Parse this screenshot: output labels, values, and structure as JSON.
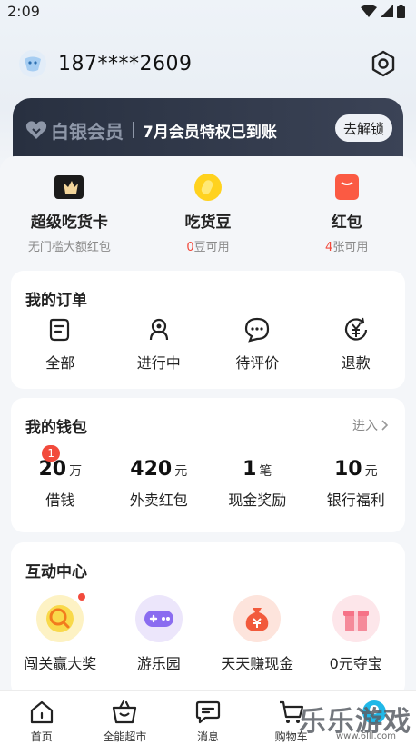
{
  "status_bar": {
    "time": "2:09"
  },
  "profile": {
    "phone": "187****2609"
  },
  "vip": {
    "brand": "白银会员",
    "message": "7月会员特权已到账",
    "button": "去解锁"
  },
  "assets": [
    {
      "title": "超级吃货卡",
      "sub": "无门槛大额红包",
      "sub_num": "",
      "sub_rest": ""
    },
    {
      "title": "吃货豆",
      "sub": "",
      "sub_num": "0",
      "sub_rest": "豆可用"
    },
    {
      "title": "红包",
      "sub": "",
      "sub_num": "4",
      "sub_rest": "张可用"
    }
  ],
  "orders": {
    "title": "我的订单",
    "items": [
      {
        "label": "全部",
        "icon": "document-icon"
      },
      {
        "label": "进行中",
        "icon": "rider-icon"
      },
      {
        "label": "待评价",
        "icon": "chat-bubble-icon"
      },
      {
        "label": "退款",
        "icon": "refund-icon"
      }
    ]
  },
  "wallet": {
    "title": "我的钱包",
    "link": "进入",
    "items": [
      {
        "value": "20",
        "unit": "万",
        "label": "借钱",
        "badge": "1"
      },
      {
        "value": "420",
        "unit": "元",
        "label": "外卖红包"
      },
      {
        "value": "1",
        "unit": "笔",
        "label": "现金奖励"
      },
      {
        "value": "10",
        "unit": "元",
        "label": "银行福利"
      }
    ]
  },
  "interactive": {
    "title": "互动中心",
    "items": [
      {
        "label": "闯关赢大奖",
        "icon": "magnifier-coin-icon",
        "color": "#f9d94a"
      },
      {
        "label": "游乐园",
        "icon": "gamepad-icon",
        "color": "#8a6cf0"
      },
      {
        "label": "天天赚现金",
        "icon": "money-bag-icon",
        "color": "#f25a3c"
      },
      {
        "label": "0元夺宝",
        "icon": "gift-box-icon",
        "color": "#f58a9a"
      }
    ]
  },
  "tabbar": [
    {
      "label": "首页",
      "icon": "home-icon"
    },
    {
      "label": "全能超市",
      "icon": "basket-icon"
    },
    {
      "label": "消息",
      "icon": "message-icon"
    },
    {
      "label": "购物车",
      "icon": "cart-icon"
    },
    {
      "label": "",
      "icon": "profile-icon"
    }
  ],
  "watermark": {
    "text": "乐乐游戏",
    "url": "www.6lll.com"
  },
  "colors": {
    "accent_red": "#f24a3c",
    "vip_dark": "#283040"
  }
}
